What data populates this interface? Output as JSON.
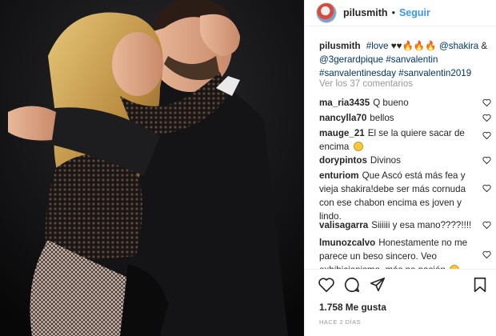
{
  "post": {
    "author": "pilusmith",
    "separator": "•",
    "follow_label": "Seguir"
  },
  "caption": {
    "username": "pilusmith",
    "tag_love": "#love",
    "emojis": "♥♥🔥🔥🔥",
    "mention1": "@shakira",
    "amp": "&",
    "mention2": "@3gerardpique",
    "tag2": "#sanvalentin",
    "tag3": "#sanvalentinesday",
    "tag4": "#sanvalentin2019"
  },
  "view_all_label": "Ver los 37 comentarios",
  "comments": [
    {
      "username": "ma_ria3435",
      "text": "Q bueno"
    },
    {
      "username": "nancylla70",
      "text": "bellos"
    },
    {
      "username": "mauge_21",
      "text": "El se la quiere sacar de encima"
    },
    {
      "username": "dorypintos",
      "text": "Divinos"
    },
    {
      "username": "enturiom",
      "text": "Que Ascó está más fea y vieja shakira!debe ser más cornuda con ese chabon encima es joven y lindo."
    },
    {
      "username": "valisagarra",
      "text": "Siiiiii y esa mano????!!!!"
    },
    {
      "username": "lmunozcalvo",
      "text": "Honestamente no me parece un beso sincero. Veo exhibicionismo, más no pasión"
    }
  ],
  "likes_label": "1.758 Me gusta",
  "time_ago": "HACE 2 DÍAS",
  "icons": {
    "like": "heart-icon",
    "comment": "comment-bubble-icon",
    "share": "share-icon",
    "save": "bookmark-icon"
  },
  "colors": {
    "link": "#003569",
    "follow": "#3897f0",
    "muted": "#999999"
  }
}
